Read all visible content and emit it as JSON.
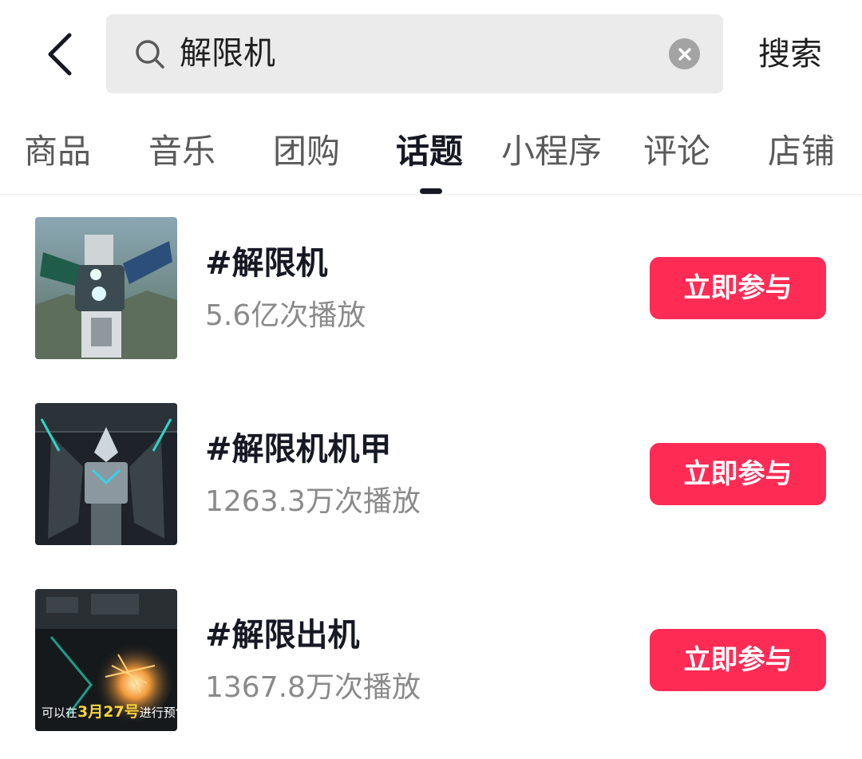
{
  "header": {
    "search_query": "解限机",
    "search_button_label": "搜索"
  },
  "tabs": [
    {
      "label": "商品",
      "active": false
    },
    {
      "label": "音乐",
      "active": false
    },
    {
      "label": "团购",
      "active": false
    },
    {
      "label": "话题",
      "active": true
    },
    {
      "label": "小程序",
      "active": false
    },
    {
      "label": "评论",
      "active": false
    },
    {
      "label": "店铺",
      "active": false
    }
  ],
  "topics": [
    {
      "title": "#解限机",
      "stats": "5.6亿次播放",
      "join_label": "立即参与"
    },
    {
      "title": "#解限机机甲",
      "stats": "1263.3万次播放",
      "join_label": "立即参与"
    },
    {
      "title": "#解限出机",
      "stats": "1367.8万次播放",
      "join_label": "立即参与",
      "thumb_caption": {
        "prefix": "可以在",
        "highlight": "3月27号",
        "suffix": "进行预售"
      }
    }
  ],
  "colors": {
    "accent": "#fe2c55",
    "text_primary": "#161823",
    "text_secondary": "#8a8a8a",
    "search_bg": "#ebebeb"
  }
}
